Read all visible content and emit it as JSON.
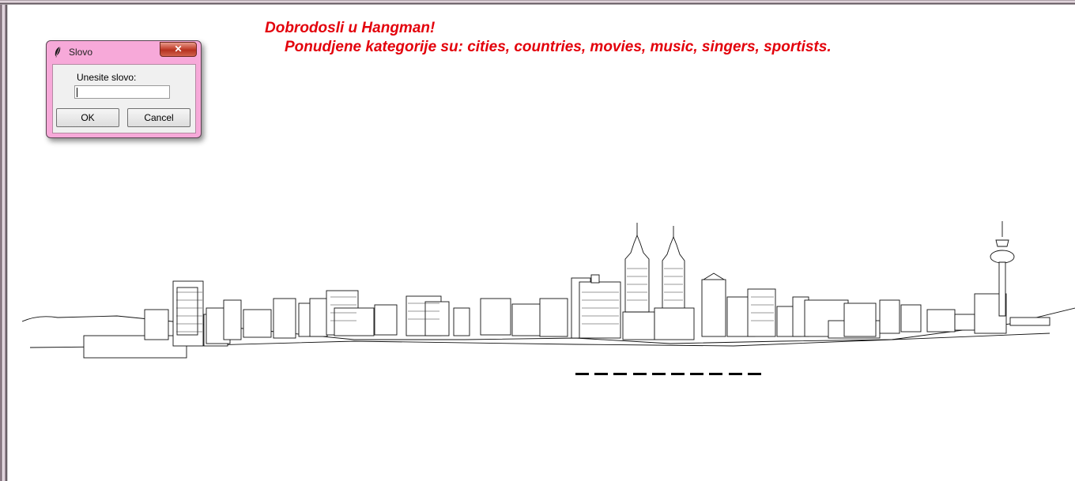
{
  "window": {
    "headline": "Dobrodosli u Hangman!",
    "categories_line": "Ponudjene kategorije su: cities, countries, movies, music, singers, sportists.",
    "text_color": "#e3000b"
  },
  "dialog": {
    "title": "Slovo",
    "icon": "feather-icon",
    "close_label": "✕",
    "prompt_label": "Unesite slovo:",
    "input_value": "",
    "ok_label": "OK",
    "cancel_label": "Cancel",
    "frame_color": "#f7a9d9"
  },
  "game": {
    "hidden_word_length": 10,
    "revealed_letters": []
  },
  "background": {
    "image": "city-skyline-sketch"
  }
}
